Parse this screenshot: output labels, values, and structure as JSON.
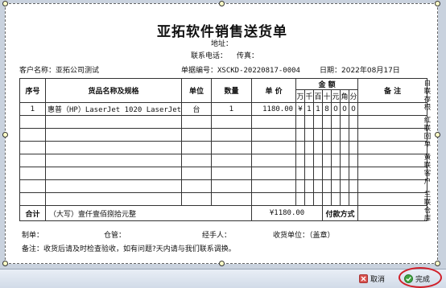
{
  "doc": {
    "company_title": "亚拓软件销售送货单",
    "address_label": "地址：",
    "phone_label": "联系电话：",
    "fax_label": "传真：",
    "customer": "客户名称：亚拓公司测试",
    "doc_no": "单据编号：XSCKD-20220817-0004",
    "date": "日期：2022年08月17日"
  },
  "table": {
    "headers": {
      "seq": "序号",
      "name": "货品名称及规格",
      "unit": "单位",
      "qty": "数量",
      "price": "单 价",
      "amount": "金  额",
      "remark": "备  注"
    },
    "digit_headers": [
      "万",
      "千",
      "百",
      "十",
      "元",
      "角",
      "分"
    ],
    "rows": [
      {
        "seq": "1",
        "name": "惠普（HP）LaserJet 1020 LaserJet",
        "unit": "台",
        "qty": "1",
        "price": "1180.00",
        "digits": [
          "¥",
          "1",
          "1",
          "8",
          "0",
          "0",
          "0"
        ]
      }
    ],
    "total_label": "合计",
    "total_words": "（大写）壹仟壹佰捌拾元整",
    "total_amount": "¥1180.00",
    "pay_label": "付款方式"
  },
  "side": [
    "白联存根",
    "红联回单",
    "黄联客户",
    "兰联仓库"
  ],
  "footer": {
    "maker": "制单：",
    "warehouse": "仓管：",
    "handler": "经手人：",
    "receiver": "收货单位：（盖章）",
    "note": "备注：收货后请及时检查验收，如有问题?天内请与我们联系调换。"
  },
  "bar": {
    "cancel": "取消",
    "done": "完成"
  }
}
